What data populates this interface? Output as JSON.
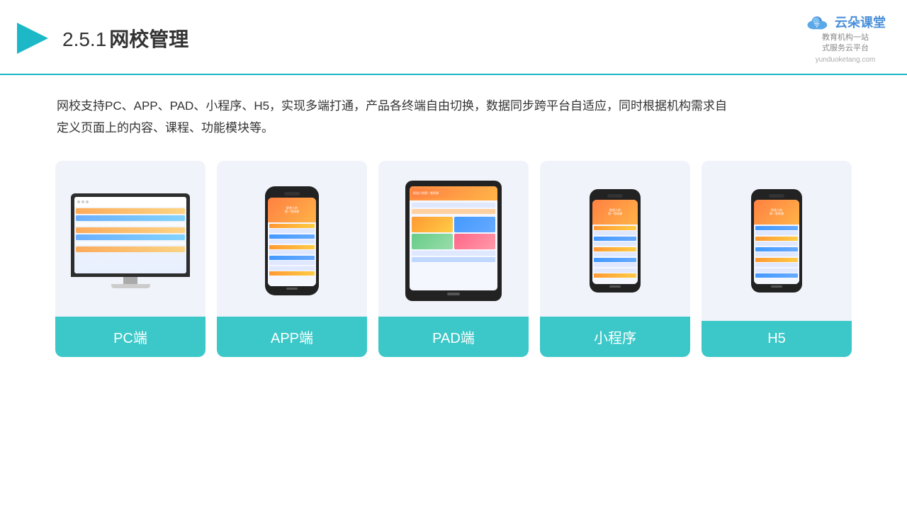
{
  "header": {
    "section_number": "2.5.1",
    "title": "网校管理",
    "logo_brand": "云朵课堂",
    "logo_url": "yunduoketang.com",
    "logo_tagline": "教育机构一站\n式服务云平台"
  },
  "description": {
    "text": "网校支持PC、APP、PAD、小程序、H5，实现多端打通，产品各终端自由切换，数据同步跨平台自适应，同时根据机构需求自定义页面上的内容、课程、功能模块等。"
  },
  "cards": [
    {
      "id": "pc",
      "label": "PC端"
    },
    {
      "id": "app",
      "label": "APP端"
    },
    {
      "id": "pad",
      "label": "PAD端"
    },
    {
      "id": "miniprogram",
      "label": "小程序"
    },
    {
      "id": "h5",
      "label": "H5"
    }
  ],
  "colors": {
    "accent": "#3cc8c8",
    "header_border": "#1cb8c7",
    "card_bg": "#f0f4fa",
    "title_color": "#333333",
    "text_color": "#333333"
  }
}
